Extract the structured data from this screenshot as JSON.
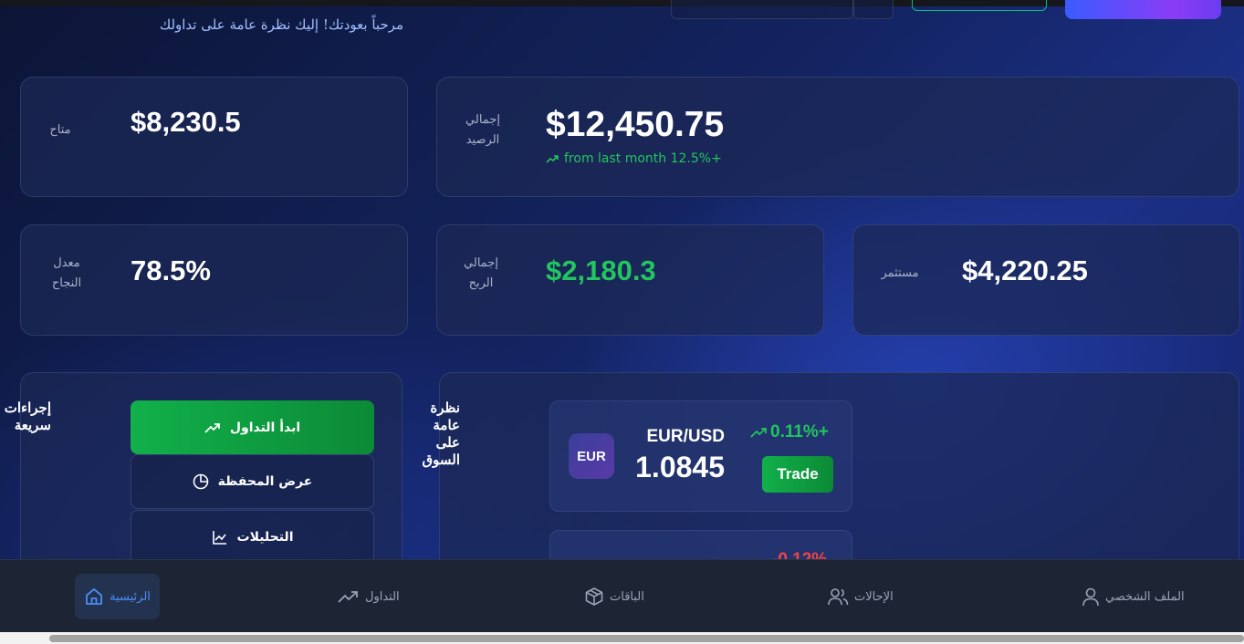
{
  "header": {
    "welcome": "مرحباً بعودتك! إليك نظرة عامة على تداولك"
  },
  "stats": {
    "available": {
      "label": "متاح",
      "value": "$8,230.5"
    },
    "total_balance": {
      "label": "إجمالي الرصيد",
      "value": "$12,450.75",
      "growth": "from last month 12.5%+"
    },
    "success_rate": {
      "label": "معدل النجاح",
      "value": "78.5%"
    },
    "total_profit": {
      "label": "إجمالي الربح",
      "value": "$2,180.3"
    },
    "invested": {
      "label": "مستثمر",
      "value": "$4,220.25"
    }
  },
  "quick_actions": {
    "title": "إجراءات سريعة",
    "start_trading": "ابدأ التداول",
    "view_portfolio": "عرض المحفظة",
    "analytics": "التحليلات"
  },
  "market_overview": {
    "title": "نظرة عامة على السوق",
    "pairs": [
      {
        "badge": "EUR",
        "name": "EUR/USD",
        "price": "1.0845",
        "change": "0.11%+",
        "trade_label": "Trade"
      },
      {
        "change": "-0.12%"
      }
    ]
  },
  "nav": {
    "home": "الرئيسية",
    "trading": "التداول",
    "packages": "الباقات",
    "referrals": "الإحالات",
    "profile": "الملف الشخصي"
  },
  "colors": {
    "accent_green": "#22c55e",
    "accent_blue": "#4a8df8",
    "negative_red": "#ef4444"
  }
}
